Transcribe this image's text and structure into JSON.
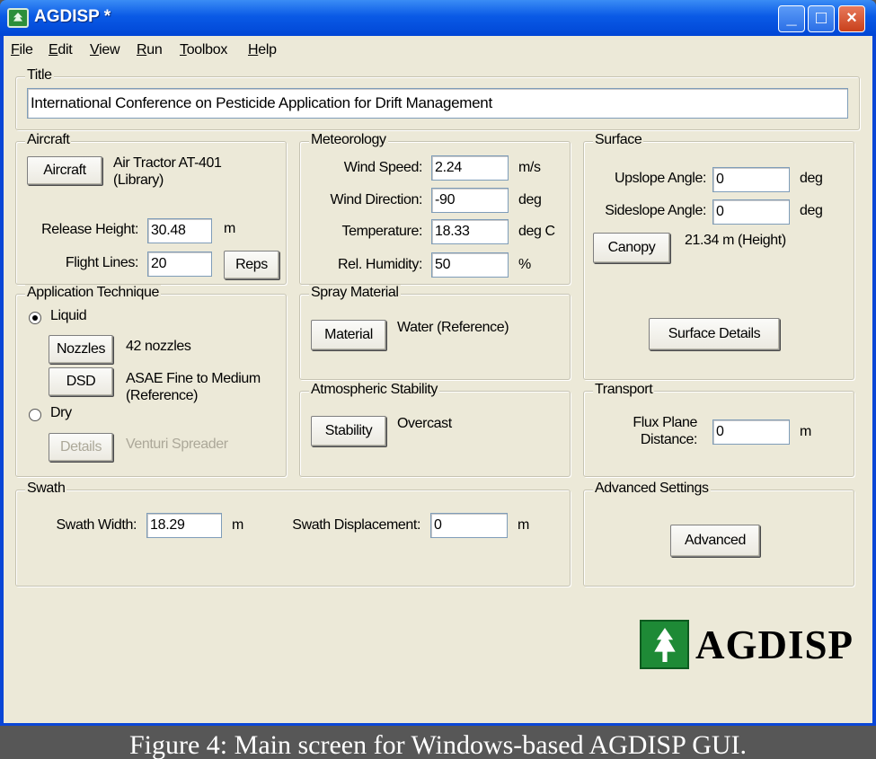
{
  "window": {
    "title": "AGDISP *",
    "controls": {
      "minimize": "_",
      "maximize": "□",
      "close": "×"
    }
  },
  "menu": [
    "File",
    "Edit",
    "View",
    "Run",
    "Toolbox",
    "Help"
  ],
  "title_group": {
    "legend": "Title",
    "value": "International Conference on Pesticide Application for Drift Management"
  },
  "aircraft": {
    "legend": "Aircraft",
    "button": "Aircraft",
    "name_line1": "Air Tractor AT-401",
    "name_line2": "(Library)",
    "release_height_label": "Release Height:",
    "release_height": "30.48",
    "release_height_unit": "m",
    "flight_lines_label": "Flight Lines:",
    "flight_lines": "20",
    "reps_button": "Reps"
  },
  "meteorology": {
    "legend": "Meteorology",
    "rows": [
      {
        "label": "Wind Speed:",
        "value": "2.24",
        "unit": "m/s"
      },
      {
        "label": "Wind Direction:",
        "value": "-90",
        "unit": "deg"
      },
      {
        "label": "Temperature:",
        "value": "18.33",
        "unit": "deg C"
      },
      {
        "label": "Rel. Humidity:",
        "value": "50",
        "unit": "%"
      }
    ]
  },
  "surface": {
    "legend": "Surface",
    "upslope_label": "Upslope Angle:",
    "upslope": "0",
    "upslope_unit": "deg",
    "sideslope_label": "Sideslope Angle:",
    "sideslope": "0",
    "sideslope_unit": "deg",
    "canopy_button": "Canopy",
    "canopy_value": "21.34 m (Height)",
    "details_button": "Surface Details"
  },
  "application": {
    "legend": "Application Technique",
    "liquid_label": "Liquid",
    "nozzles_button": "Nozzles",
    "nozzles_value": "42 nozzles",
    "dsd_button": "DSD",
    "dsd_line1": "ASAE Fine to Medium",
    "dsd_line2": "(Reference)",
    "dry_label": "Dry",
    "details_button": "Details",
    "dry_value": "Venturi Spreader"
  },
  "spray_material": {
    "legend": "Spray Material",
    "button": "Material",
    "value": "Water (Reference)"
  },
  "stability": {
    "legend": "Atmospheric Stability",
    "button": "Stability",
    "value": "Overcast"
  },
  "transport": {
    "legend": "Transport",
    "label_line1": "Flux Plane",
    "label_line2": "Distance:",
    "value": "0",
    "unit": "m"
  },
  "swath": {
    "legend": "Swath",
    "width_label": "Swath Width:",
    "width": "18.29",
    "width_unit": "m",
    "displacement_label": "Swath Displacement:",
    "displacement": "0",
    "displacement_unit": "m"
  },
  "advanced": {
    "legend": "Advanced Settings",
    "button": "Advanced"
  },
  "logo": {
    "text": "AGDISP"
  },
  "caption": "Figure 4: Main screen for Windows-based AGDISP GUI."
}
